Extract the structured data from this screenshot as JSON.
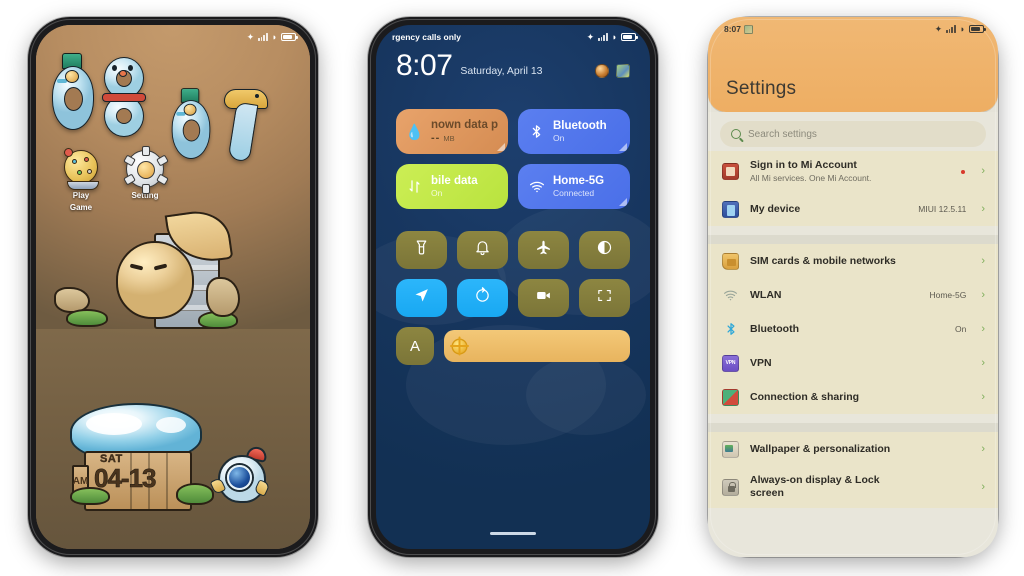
{
  "page": {
    "background": "#ffffff",
    "device_count": 3
  },
  "phone_home": {
    "status_bar": {
      "bluetooth_icon": "bluetooth-icon",
      "signal_icon": "signal-bars-icon",
      "wifi_icon": "wifi-icon",
      "battery_icon": "battery-icon"
    },
    "wallpaper_theme": "cartoon-numbers-brown-landscape",
    "clock_numbers": [
      "0",
      "8",
      "0",
      "7"
    ],
    "apps": [
      {
        "label_line1": "Play",
        "label_line2": "Game",
        "icon": "play-game-icon"
      },
      {
        "label_line1": "Setting",
        "label_line2": "",
        "icon": "setting-gear-icon"
      }
    ],
    "date_widget": {
      "weekday": "SAT",
      "date": "04-13",
      "meridiem": "AM"
    }
  },
  "phone_control_center": {
    "status_bar": {
      "carrier_text": "rgency calls only",
      "bluetooth_icon": "bluetooth-icon",
      "signal_icon": "signal-bars-icon",
      "wifi_icon": "wifi-icon",
      "battery_icon": "battery-icon"
    },
    "clock": {
      "time": "8:07",
      "date": "Saturday, April 13"
    },
    "shortcuts": [
      {
        "name": "settings-shortcut-icon"
      },
      {
        "name": "gallery-shortcut-icon"
      }
    ],
    "big_tiles": [
      {
        "title": "nown data pl",
        "value": "--",
        "unit": "MB",
        "icon": "water-drop-icon",
        "state": "orange",
        "color": "#e8a36b"
      },
      {
        "title": "Bluetooth",
        "subtitle": "On",
        "icon": "bluetooth-icon",
        "state": "on",
        "color": "#5b7ff0"
      },
      {
        "title": "bile data",
        "subtitle": "On",
        "icon": "data-transfer-icon",
        "state": "on",
        "color": "#ccee55"
      },
      {
        "title": "Home-5G",
        "subtitle": "Connected",
        "icon": "wifi-icon",
        "state": "connected",
        "color": "#5b7ff0"
      }
    ],
    "toggles": [
      {
        "name": "flashlight-icon",
        "state": "off"
      },
      {
        "name": "silent-bell-icon",
        "state": "off"
      },
      {
        "name": "airplane-mode-icon",
        "state": "off"
      },
      {
        "name": "dark-mode-icon",
        "state": "off"
      },
      {
        "name": "location-icon",
        "state": "on"
      },
      {
        "name": "auto-rotate-icon",
        "state": "on"
      },
      {
        "name": "screen-recorder-icon",
        "state": "off"
      },
      {
        "name": "scanner-icon",
        "state": "off"
      }
    ],
    "auto_brightness": {
      "label": "A",
      "state": "off"
    },
    "brightness_slider": {
      "icon": "sun-icon",
      "level_percent": 100
    },
    "home_indicator": "home-bar"
  },
  "phone_settings": {
    "status_bar": {
      "time": "8:07",
      "app_icon": "mini-app-icon",
      "bluetooth_icon": "bluetooth-icon",
      "signal_icon": "signal-bars-icon",
      "wifi_icon": "wifi-icon",
      "battery_icon": "battery-icon"
    },
    "header": {
      "title": "Settings",
      "color": "#eeae63"
    },
    "search": {
      "placeholder": "Search settings",
      "icon": "search-icon"
    },
    "groups": [
      {
        "items": [
          {
            "title": "Sign in to Mi Account",
            "subtitle": "All Mi services. One Mi Account.",
            "value": "",
            "badge": true,
            "icon": "mi-account-icon"
          },
          {
            "title": "My device",
            "subtitle": "",
            "value": "MIUI 12.5.11",
            "badge": false,
            "icon": "my-device-icon"
          }
        ]
      },
      {
        "items": [
          {
            "title": "SIM cards & mobile networks",
            "subtitle": "",
            "value": "",
            "badge": false,
            "icon": "sim-card-icon"
          },
          {
            "title": "WLAN",
            "subtitle": "",
            "value": "Home-5G",
            "badge": false,
            "icon": "wifi-icon"
          },
          {
            "title": "Bluetooth",
            "subtitle": "",
            "value": "On",
            "badge": false,
            "icon": "bluetooth-icon"
          },
          {
            "title": "VPN",
            "subtitle": "",
            "value": "",
            "badge": false,
            "icon": "vpn-icon"
          },
          {
            "title": "Connection & sharing",
            "subtitle": "",
            "value": "",
            "badge": false,
            "icon": "connection-sharing-icon"
          }
        ]
      },
      {
        "items": [
          {
            "title": "Wallpaper & personalization",
            "subtitle": "",
            "value": "",
            "badge": false,
            "icon": "wallpaper-icon"
          },
          {
            "title": "Always-on display & Lock screen",
            "subtitle": "",
            "value": "",
            "badge": false,
            "icon": "lock-screen-icon"
          }
        ]
      }
    ],
    "chevron_glyph": "›"
  }
}
